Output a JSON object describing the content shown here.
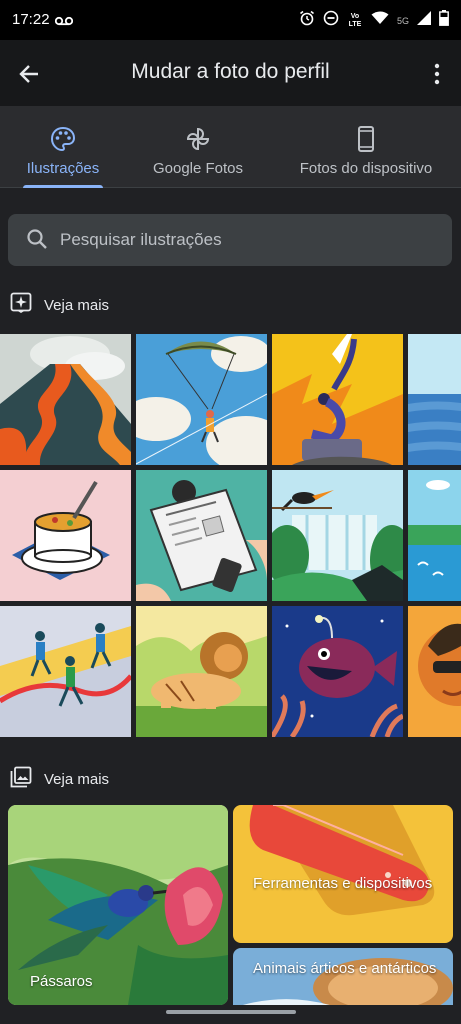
{
  "status_bar": {
    "time": "17:22",
    "network_label": "5G",
    "volte_label": "Vo LTE"
  },
  "app_bar": {
    "title": "Mudar a foto do perfil",
    "back_icon": "arrow-back-icon",
    "more_icon": "more-vert-icon"
  },
  "tabs": [
    {
      "label": "Ilustrações",
      "icon": "palette-icon",
      "active": true
    },
    {
      "label": "Google Fotos",
      "icon": "pinwheel-icon",
      "active": false
    },
    {
      "label": "Fotos do dispositivo",
      "icon": "phone-icon",
      "active": false
    }
  ],
  "search": {
    "placeholder": "Pesquisar ilustrações"
  },
  "sections": [
    {
      "title": "Veja mais",
      "icon": "sparkle-icon"
    },
    {
      "title": "Veja mais",
      "icon": "photo-library-icon"
    }
  ],
  "illustrations": [
    "volcano-illustration",
    "parachute-illustration",
    "gymnast-illustration",
    "ocean-illustration",
    "soup-illustration",
    "newspaper-illustration",
    "toucan-waterfall-illustration",
    "coast-illustration",
    "runners-illustration",
    "lion-illustration",
    "anglerfish-illustration",
    "sunglasses-person-illustration"
  ],
  "categories": [
    {
      "label": "Pássaros"
    },
    {
      "label": "Ferramentas e dispositivos"
    },
    {
      "label": "Animais árticos e antárticos"
    }
  ],
  "colors": {
    "accent": "#8ab4f8",
    "background": "#202124",
    "surface": "#2b2c2f"
  }
}
